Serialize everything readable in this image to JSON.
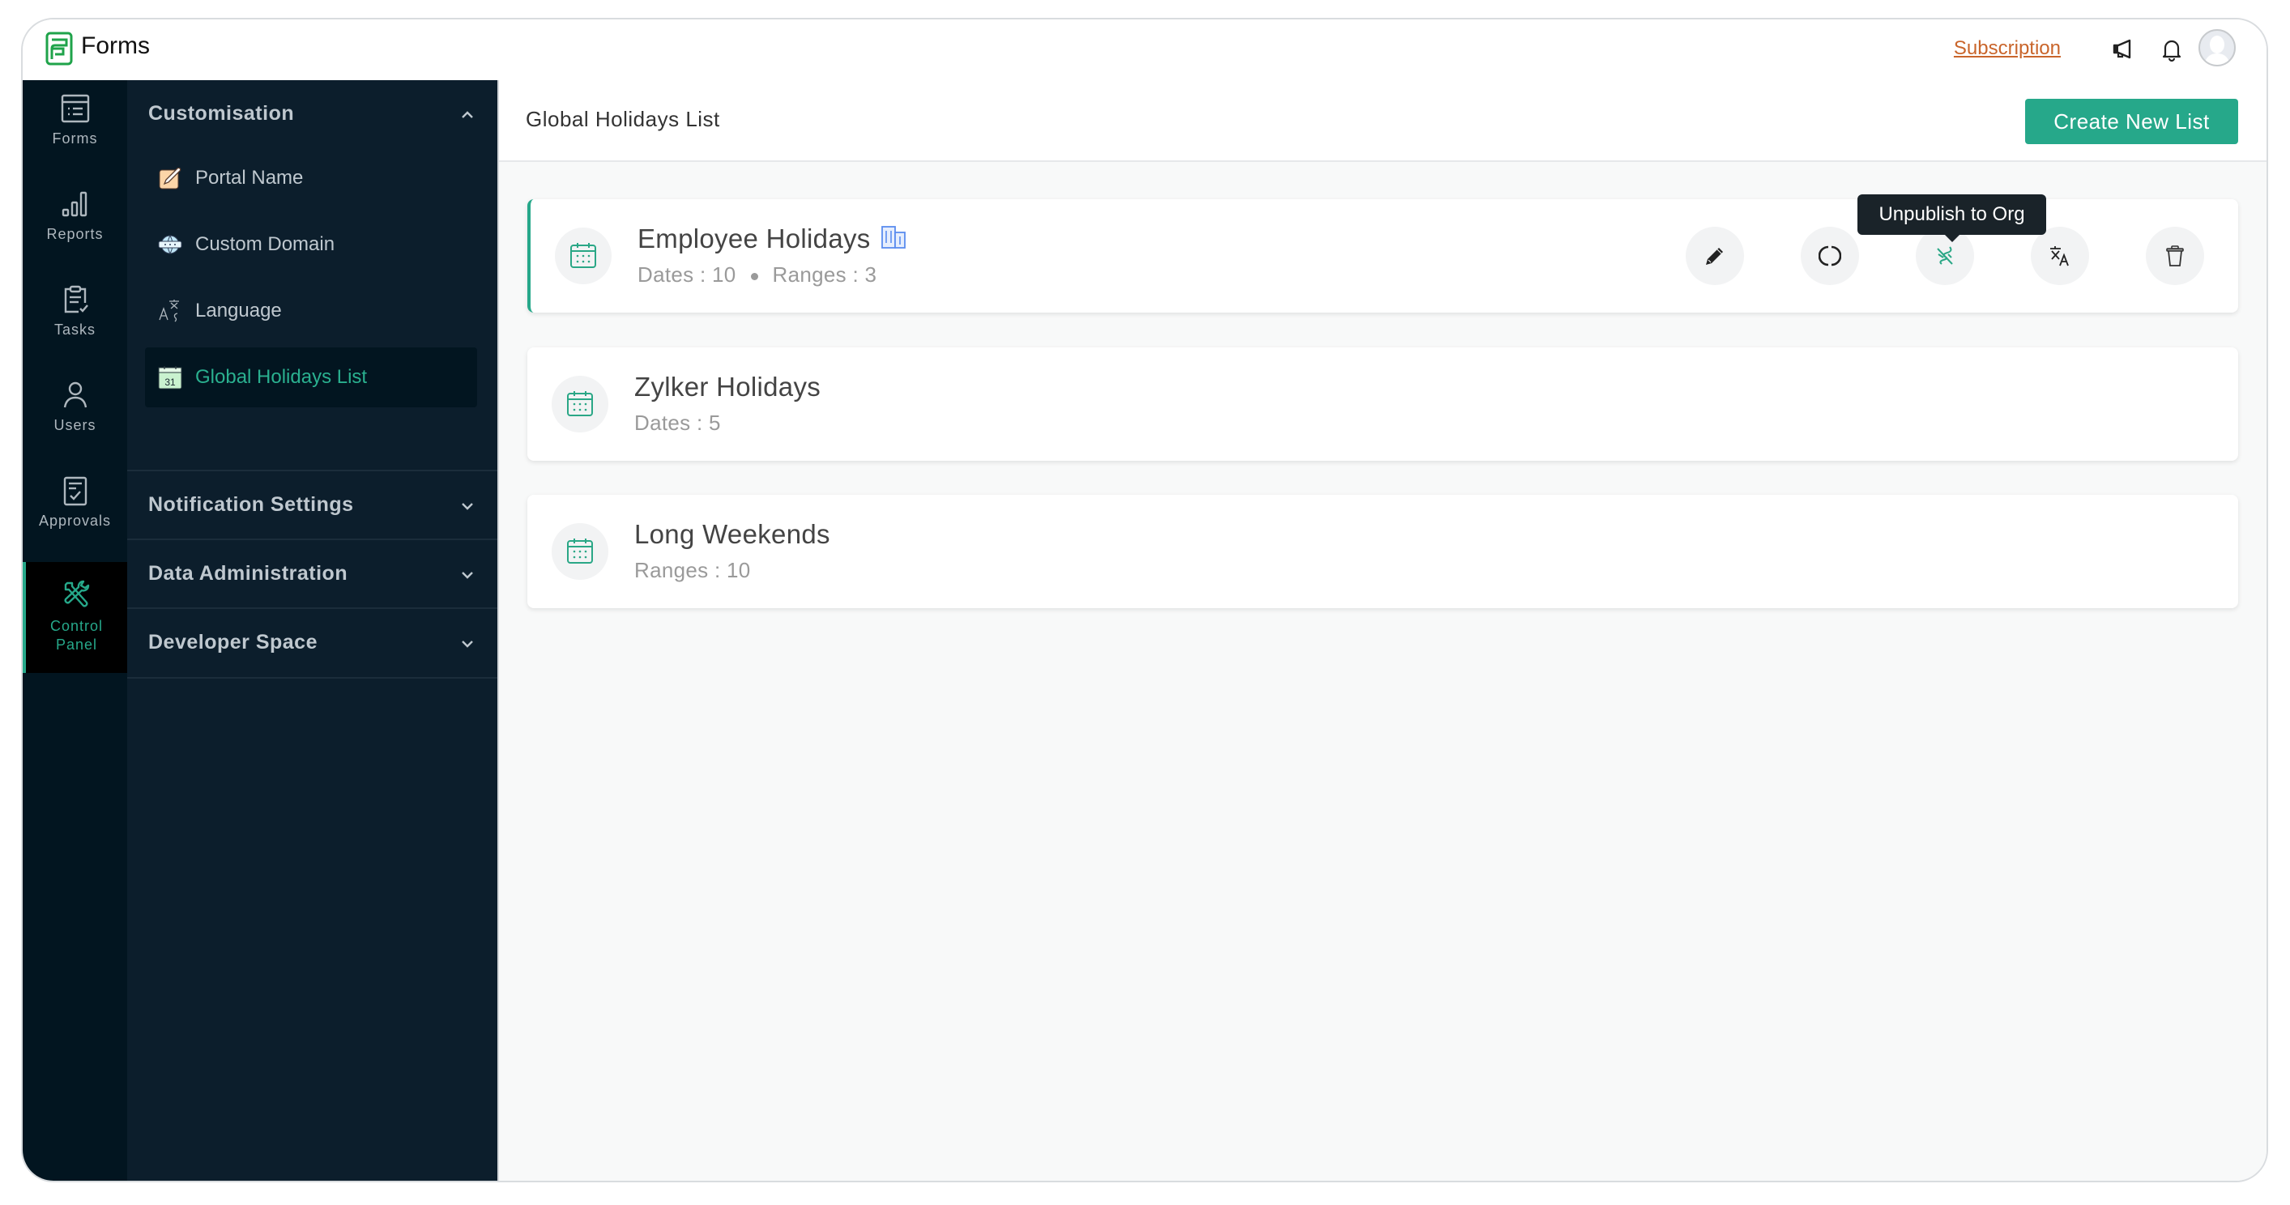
{
  "app": {
    "title": "Forms"
  },
  "topbar": {
    "subscription_label": "Subscription",
    "icons": [
      "megaphone-icon",
      "bell-icon",
      "avatar"
    ]
  },
  "rail": {
    "items": [
      {
        "label": "Forms",
        "icon": "forms-icon",
        "active": false
      },
      {
        "label": "Reports",
        "icon": "reports-icon",
        "active": false
      },
      {
        "label": "Tasks",
        "icon": "tasks-icon",
        "active": false
      },
      {
        "label": "Users",
        "icon": "users-icon",
        "active": false
      },
      {
        "label": "Approvals",
        "icon": "approvals-icon",
        "active": false
      },
      {
        "label_line1": "Control",
        "label_line2": "Panel",
        "icon": "tools-icon",
        "active": true
      }
    ]
  },
  "sidebar": {
    "sections": [
      {
        "title": "Customisation",
        "expanded": true,
        "items": [
          {
            "label": "Portal Name",
            "icon": "edit-note-icon"
          },
          {
            "label": "Custom Domain",
            "icon": "globe-icon"
          },
          {
            "label": "Language",
            "icon": "translate-icon"
          },
          {
            "label": "Global Holidays List",
            "icon": "calendar-31-icon",
            "active": true
          }
        ]
      },
      {
        "title": "Notification Settings",
        "expanded": false
      },
      {
        "title": "Data Administration",
        "expanded": false
      },
      {
        "title": "Developer Space",
        "expanded": false
      }
    ]
  },
  "main": {
    "title": "Global Holidays List",
    "create_button": "Create New List",
    "lists": [
      {
        "name": "Employee Holidays",
        "published_to_org": true,
        "meta_dates": "Dates : 10",
        "meta_ranges": "Ranges : 3",
        "selected": true
      },
      {
        "name": "Zylker Holidays",
        "meta": "Dates : 5"
      },
      {
        "name": "Long Weekends",
        "meta": "Ranges : 10"
      }
    ],
    "actions": [
      {
        "name": "edit",
        "icon": "pencil-icon"
      },
      {
        "name": "refresh",
        "icon": "refresh-icon"
      },
      {
        "name": "unpublish",
        "icon": "unpublish-icon"
      },
      {
        "name": "translate",
        "icon": "translate-icon"
      },
      {
        "name": "delete",
        "icon": "trash-icon"
      }
    ],
    "tooltip": "Unpublish to Org"
  },
  "colors": {
    "accent": "#26a88a",
    "subscription": "#c9652b",
    "rail_bg": "#021520",
    "sidebar_bg": "#0c1e2c",
    "tooltip_bg": "#1a2329"
  }
}
